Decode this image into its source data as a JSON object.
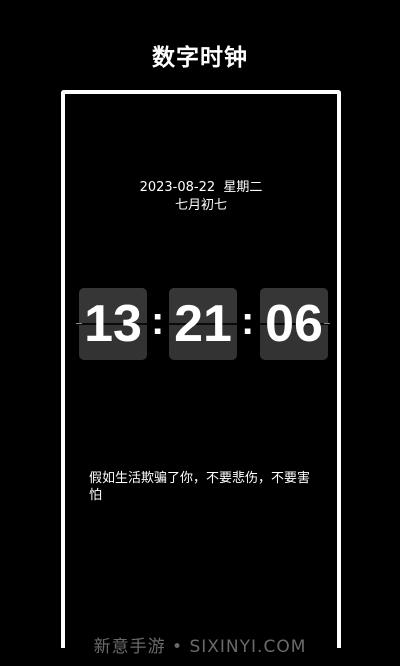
{
  "header": {
    "title": "数字时钟"
  },
  "clock_screen": {
    "date": "2023-08-22  星期二",
    "lunar_date": "七月初七",
    "time": {
      "hours": "13",
      "minutes": "21",
      "seconds": "06",
      "separator": ":"
    },
    "quote": "假如生活欺骗了你，不要悲伤，不要害怕"
  },
  "watermark": "新意手游 • SIXINYI.COM",
  "colors": {
    "background": "#000000",
    "text": "#ffffff",
    "card": "#333333"
  }
}
